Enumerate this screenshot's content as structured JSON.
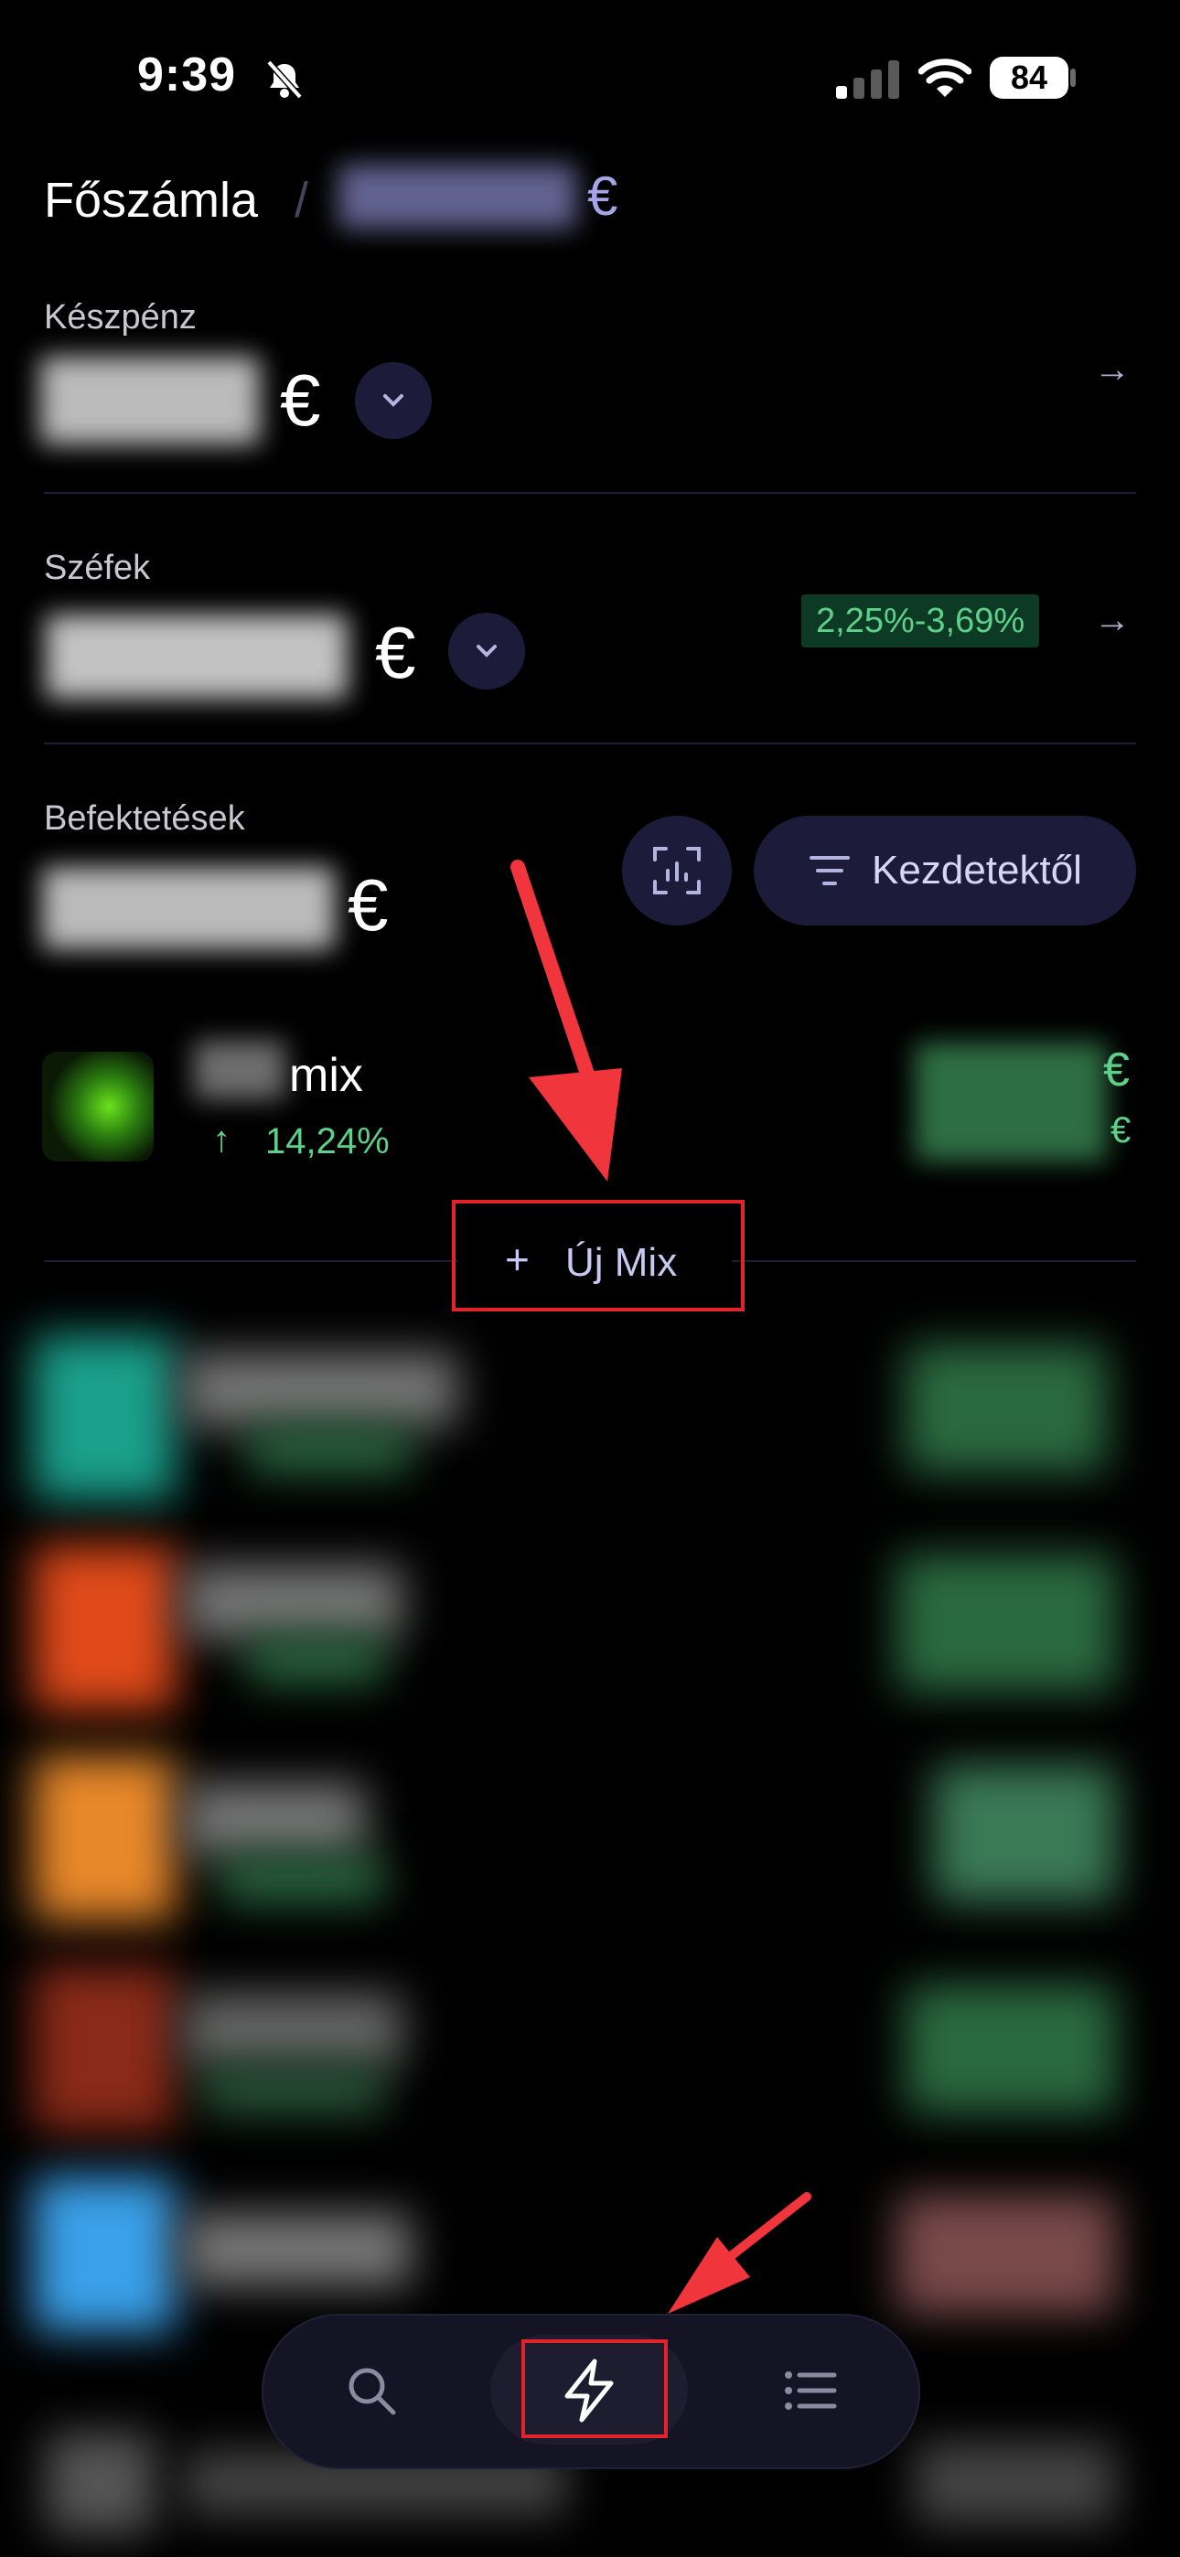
{
  "status_bar": {
    "time": "9:39",
    "battery": "84"
  },
  "header": {
    "title": "Főszámla",
    "separator": "/",
    "currency": "€"
  },
  "sections": {
    "cash": {
      "label": "Készpénz",
      "currency": "€"
    },
    "vaults": {
      "label": "Széfek",
      "currency": "€",
      "rate": "2,25%-3,69%"
    },
    "investments": {
      "label": "Befektetések",
      "currency": "€",
      "filter_label": "Kezdetektől"
    }
  },
  "mix_item": {
    "name": "mix",
    "change": "14,24%",
    "currency": "€"
  },
  "new_mix": {
    "plus": "+",
    "label": "Új Mix"
  },
  "colors": {
    "accent": "#a4a4e6",
    "positive": "#5ed08a",
    "annotation": "#e3232a"
  }
}
